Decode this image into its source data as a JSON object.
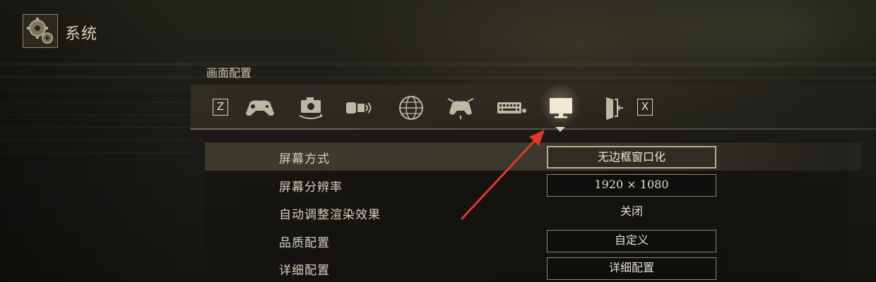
{
  "header": {
    "title": "系统",
    "logo_icon": "gear-cog-icon"
  },
  "section": {
    "title": "画面配置"
  },
  "tabs": {
    "prev_key": "Z",
    "next_key": "X",
    "items": [
      {
        "icon": "gamepad-icon"
      },
      {
        "icon": "camera-rotate-icon"
      },
      {
        "icon": "sound-icon"
      },
      {
        "icon": "globe-icon"
      },
      {
        "icon": "controller-buttons-icon"
      },
      {
        "icon": "keyboard-icon"
      },
      {
        "icon": "monitor-icon",
        "active": true
      },
      {
        "icon": "exit-door-icon"
      }
    ]
  },
  "settings": [
    {
      "label": "屏幕方式",
      "value": "无边框窗口化",
      "selected": true
    },
    {
      "label": "屏幕分辨率",
      "value": "1920 × 1080"
    },
    {
      "label": "自动调整渲染效果",
      "value": "关闭"
    },
    {
      "label": "品质配置",
      "value": "自定义"
    },
    {
      "label": "详细配置",
      "value": "详细配置"
    }
  ],
  "colors": {
    "accent": "#b8ae8e",
    "annotation_arrow": "#e03a2e",
    "text": "#d8d2c2"
  }
}
